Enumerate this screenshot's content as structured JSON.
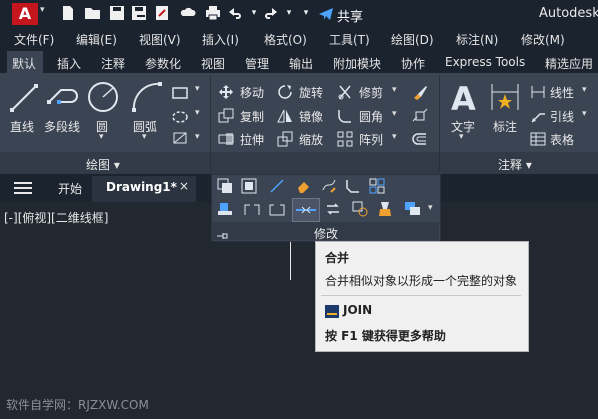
{
  "titlebar": {
    "app_logo": "A",
    "share": "共享",
    "brand": "Autodesk"
  },
  "menubar": {
    "items": [
      "文件(F)",
      "编辑(E)",
      "视图(V)",
      "插入(I)",
      "格式(O)",
      "工具(T)",
      "绘图(D)",
      "标注(N)",
      "修改(M)"
    ]
  },
  "ribbon_tabs": {
    "items": [
      "默认",
      "插入",
      "注释",
      "参数化",
      "视图",
      "管理",
      "输出",
      "附加模块",
      "协作",
      "Express Tools",
      "精选应用"
    ]
  },
  "draw_panel": {
    "tools": [
      "直线",
      "多段线",
      "圆",
      "圆弧"
    ],
    "title": "绘图 ▾"
  },
  "modify_panel": {
    "tools": [
      "移动",
      "旋转",
      "修剪",
      "复制",
      "镜像",
      "圆角",
      "拉伸",
      "缩放",
      "阵列"
    ],
    "title": "修改"
  },
  "annotation_panel": {
    "tools": [
      "文字",
      "标注",
      "线性",
      "引线",
      "表格"
    ],
    "title": "注释 ▾"
  },
  "doc_tabs": {
    "start": "开始",
    "active": "Drawing1*",
    "close": "×"
  },
  "viewport": {
    "label": "[-][俯视][二维线框]"
  },
  "tooltip": {
    "title": "合并",
    "description": "合并相似对象以形成一个完整的对象",
    "command": "JOIN",
    "help": "按 F1 键获得更多帮助"
  },
  "watermark": "软件自学网：RJZXW.COM",
  "colors": {
    "accent_red": "#c4161c",
    "ribbon_bg": "#3b4453",
    "title_bg": "#1b232f",
    "canvas_bg": "#212830"
  }
}
